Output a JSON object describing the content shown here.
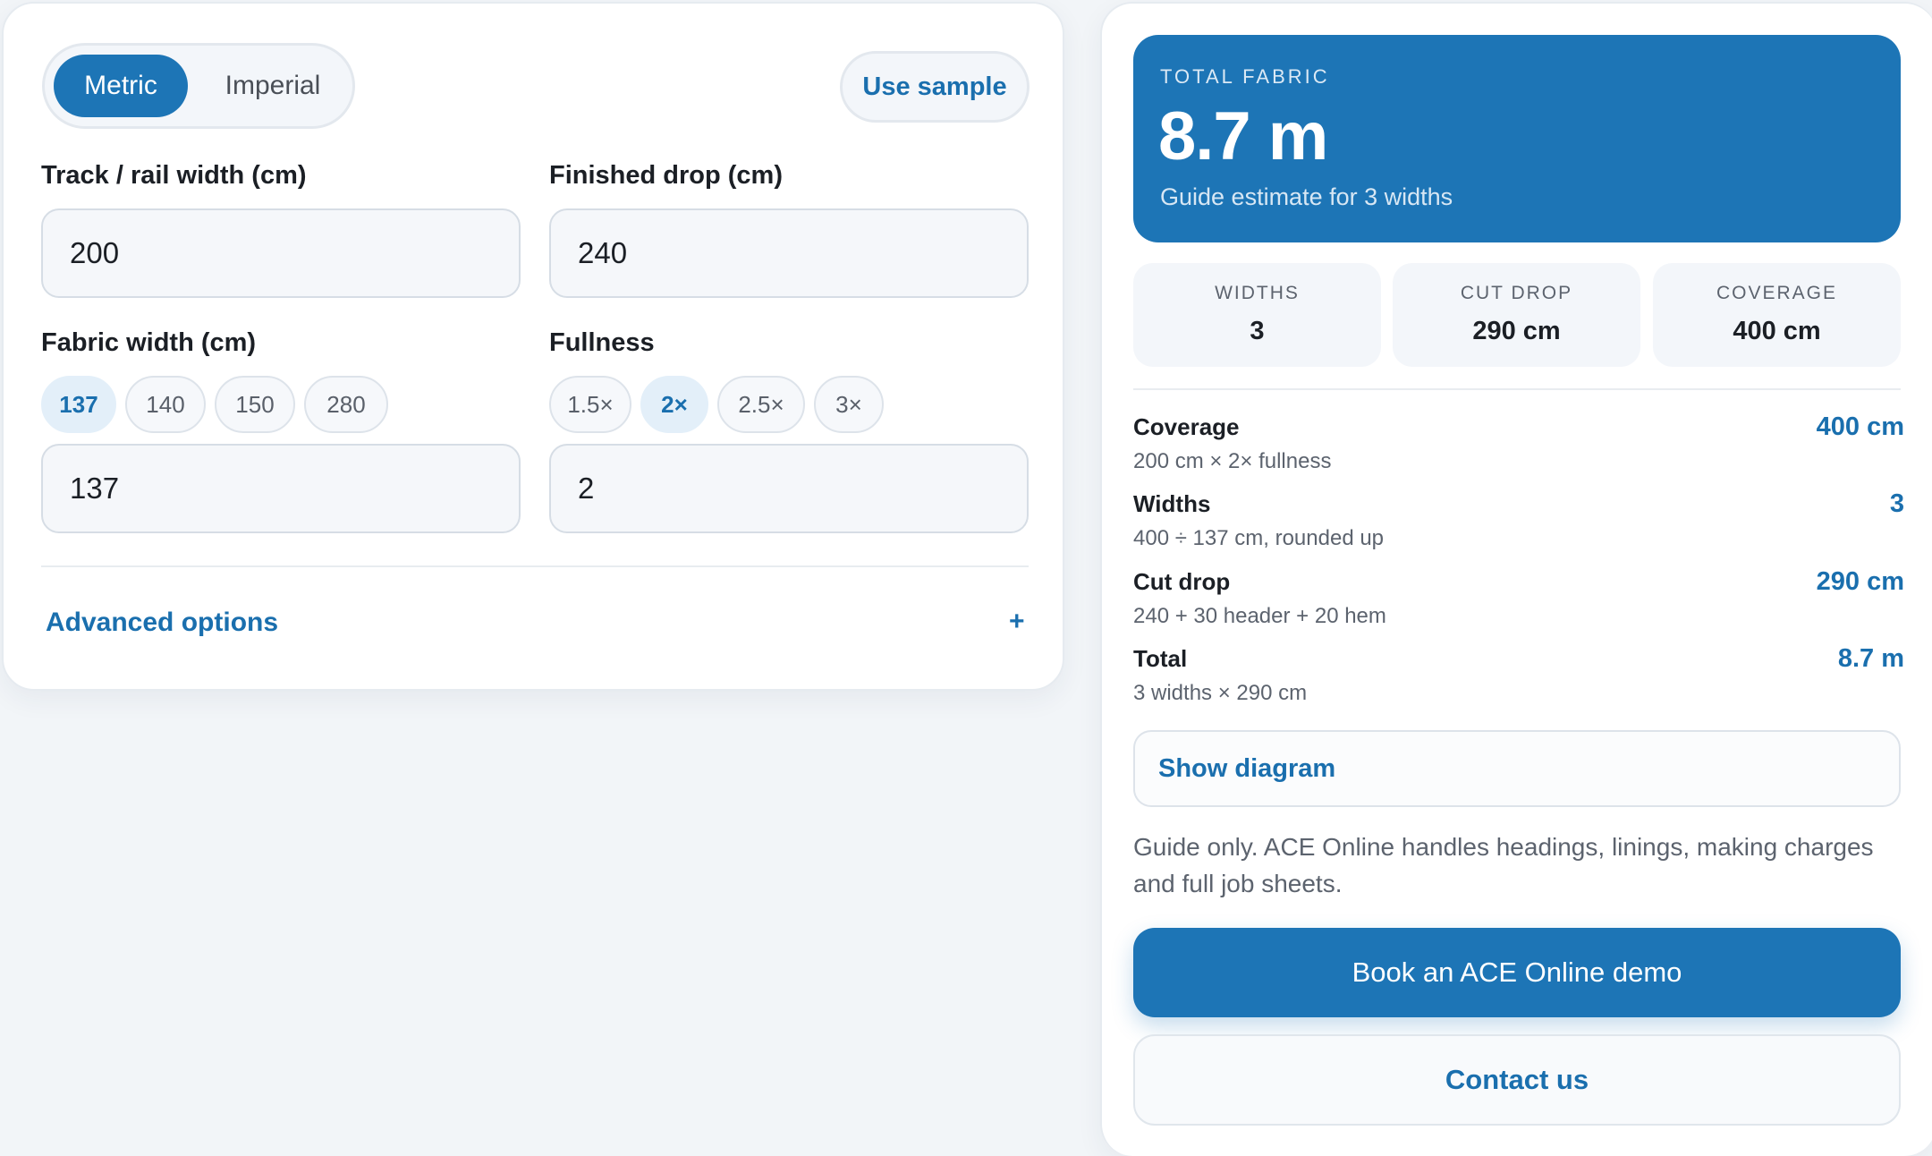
{
  "units": {
    "metric": "Metric",
    "imperial": "Imperial"
  },
  "sample_button": "Use sample",
  "track_width": {
    "label": "Track / rail width (cm)",
    "value": "200"
  },
  "finished_drop": {
    "label": "Finished drop (cm)",
    "value": "240"
  },
  "fabric_width": {
    "label": "Fabric width (cm)",
    "chips": [
      "137",
      "140",
      "150",
      "280"
    ],
    "selected": "137",
    "value": "137"
  },
  "fullness": {
    "label": "Fullness",
    "chips": [
      "1.5×",
      "2×",
      "2.5×",
      "3×"
    ],
    "selected": "2×",
    "value": "2"
  },
  "advanced": {
    "label": "Advanced options",
    "toggle": "+"
  },
  "result": {
    "eyebrow": "TOTAL FABRIC",
    "value": "8.7 m",
    "subtitle": "Guide estimate for 3 widths"
  },
  "stats": [
    {
      "label": "WIDTHS",
      "value": "3"
    },
    {
      "label": "CUT DROP",
      "value": "290 cm"
    },
    {
      "label": "COVERAGE",
      "value": "400 cm"
    }
  ],
  "breakdown": [
    {
      "title": "Coverage",
      "desc": "200 cm × 2× fullness",
      "value": "400 cm"
    },
    {
      "title": "Widths",
      "desc": "400 ÷ 137 cm, rounded up",
      "value": "3"
    },
    {
      "title": "Cut drop",
      "desc": "240 + 30 header + 20 hem",
      "value": "290 cm"
    },
    {
      "title": "Total",
      "desc": "3 widths × 290 cm",
      "value": "8.7 m"
    }
  ],
  "diagram_button": "Show diagram",
  "note": "Guide only. ACE Online handles headings, linings, making charges and full job sheets.",
  "demo_button": "Book an ACE Online demo",
  "contact_button": "Contact us",
  "colors": {
    "accent": "#1d75b6",
    "link": "#1a6fae",
    "background": "#f2f5f8"
  }
}
